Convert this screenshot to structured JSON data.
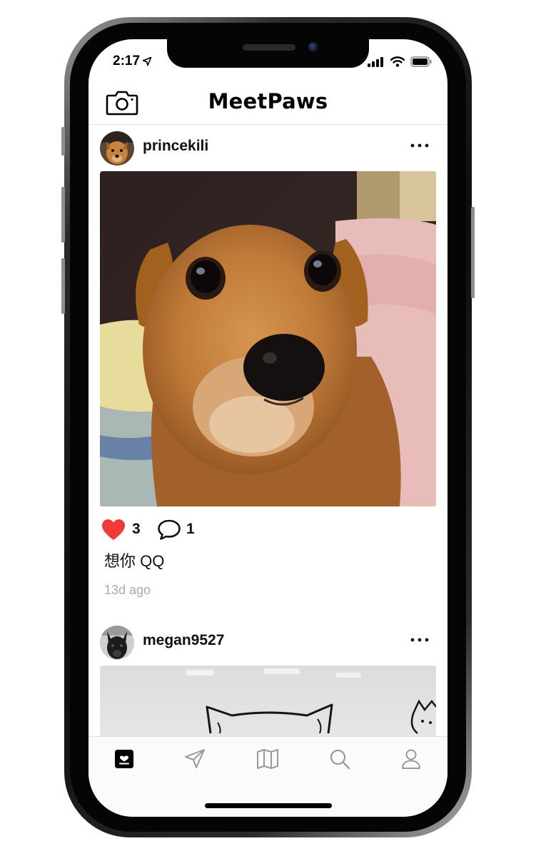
{
  "status_bar": {
    "time": "2:17",
    "location_icon": "location-arrow-icon",
    "signal_icon": "cellular-signal-icon",
    "wifi_icon": "wifi-icon",
    "battery_icon": "battery-icon"
  },
  "nav": {
    "title": "MeetPaws",
    "camera_icon": "camera-icon"
  },
  "posts": [
    {
      "username": "princekili",
      "avatar_icon": "dog-avatar",
      "photo": "close-up photo of a ginger dog",
      "like_count": "3",
      "comment_count": "1",
      "caption": "想你 QQ",
      "time_ago": "13d ago"
    },
    {
      "username": "megan9527",
      "avatar_icon": "black-dog-avatar",
      "photo": "whiteboard drawing of a cat"
    }
  ],
  "tabbar": {
    "items": [
      {
        "name": "feed",
        "icon": "feed-icon",
        "active": true
      },
      {
        "name": "messages",
        "icon": "paper-plane-icon",
        "active": false
      },
      {
        "name": "map",
        "icon": "map-icon",
        "active": false
      },
      {
        "name": "search",
        "icon": "search-icon",
        "active": false
      },
      {
        "name": "profile",
        "icon": "person-icon",
        "active": false
      }
    ]
  },
  "colors": {
    "like": "#f03a3a",
    "text": "#111111",
    "muted": "#aaaaaa",
    "tab_inactive": "#9a9a9a"
  }
}
